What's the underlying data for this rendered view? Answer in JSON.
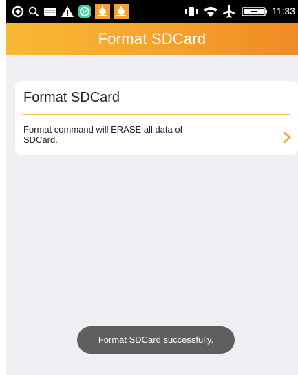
{
  "status_bar": {
    "time": "11:33",
    "left_icons": [
      "sync-icon",
      "search-icon",
      "keyboard-icon",
      "warning-icon",
      "app-p-icon",
      "notification-icon",
      "notification-icon"
    ],
    "right_icons": [
      "vibrate-icon",
      "wifi-icon",
      "airplane-icon",
      "battery-icon"
    ]
  },
  "header": {
    "title": "Format SDCard",
    "colors": {
      "start": "#f8b934",
      "end": "#f08a22"
    }
  },
  "card": {
    "title": "Format SDCard",
    "description": "Format command will ERASE all data of SDCard.",
    "chevron_icon": "chevron-right-icon",
    "accent_color": "#f4c14a"
  },
  "toast": {
    "message": "Format SDCard successfully."
  },
  "colors": {
    "background": "#efeff4",
    "toast_bg": "#5f5f5f"
  }
}
